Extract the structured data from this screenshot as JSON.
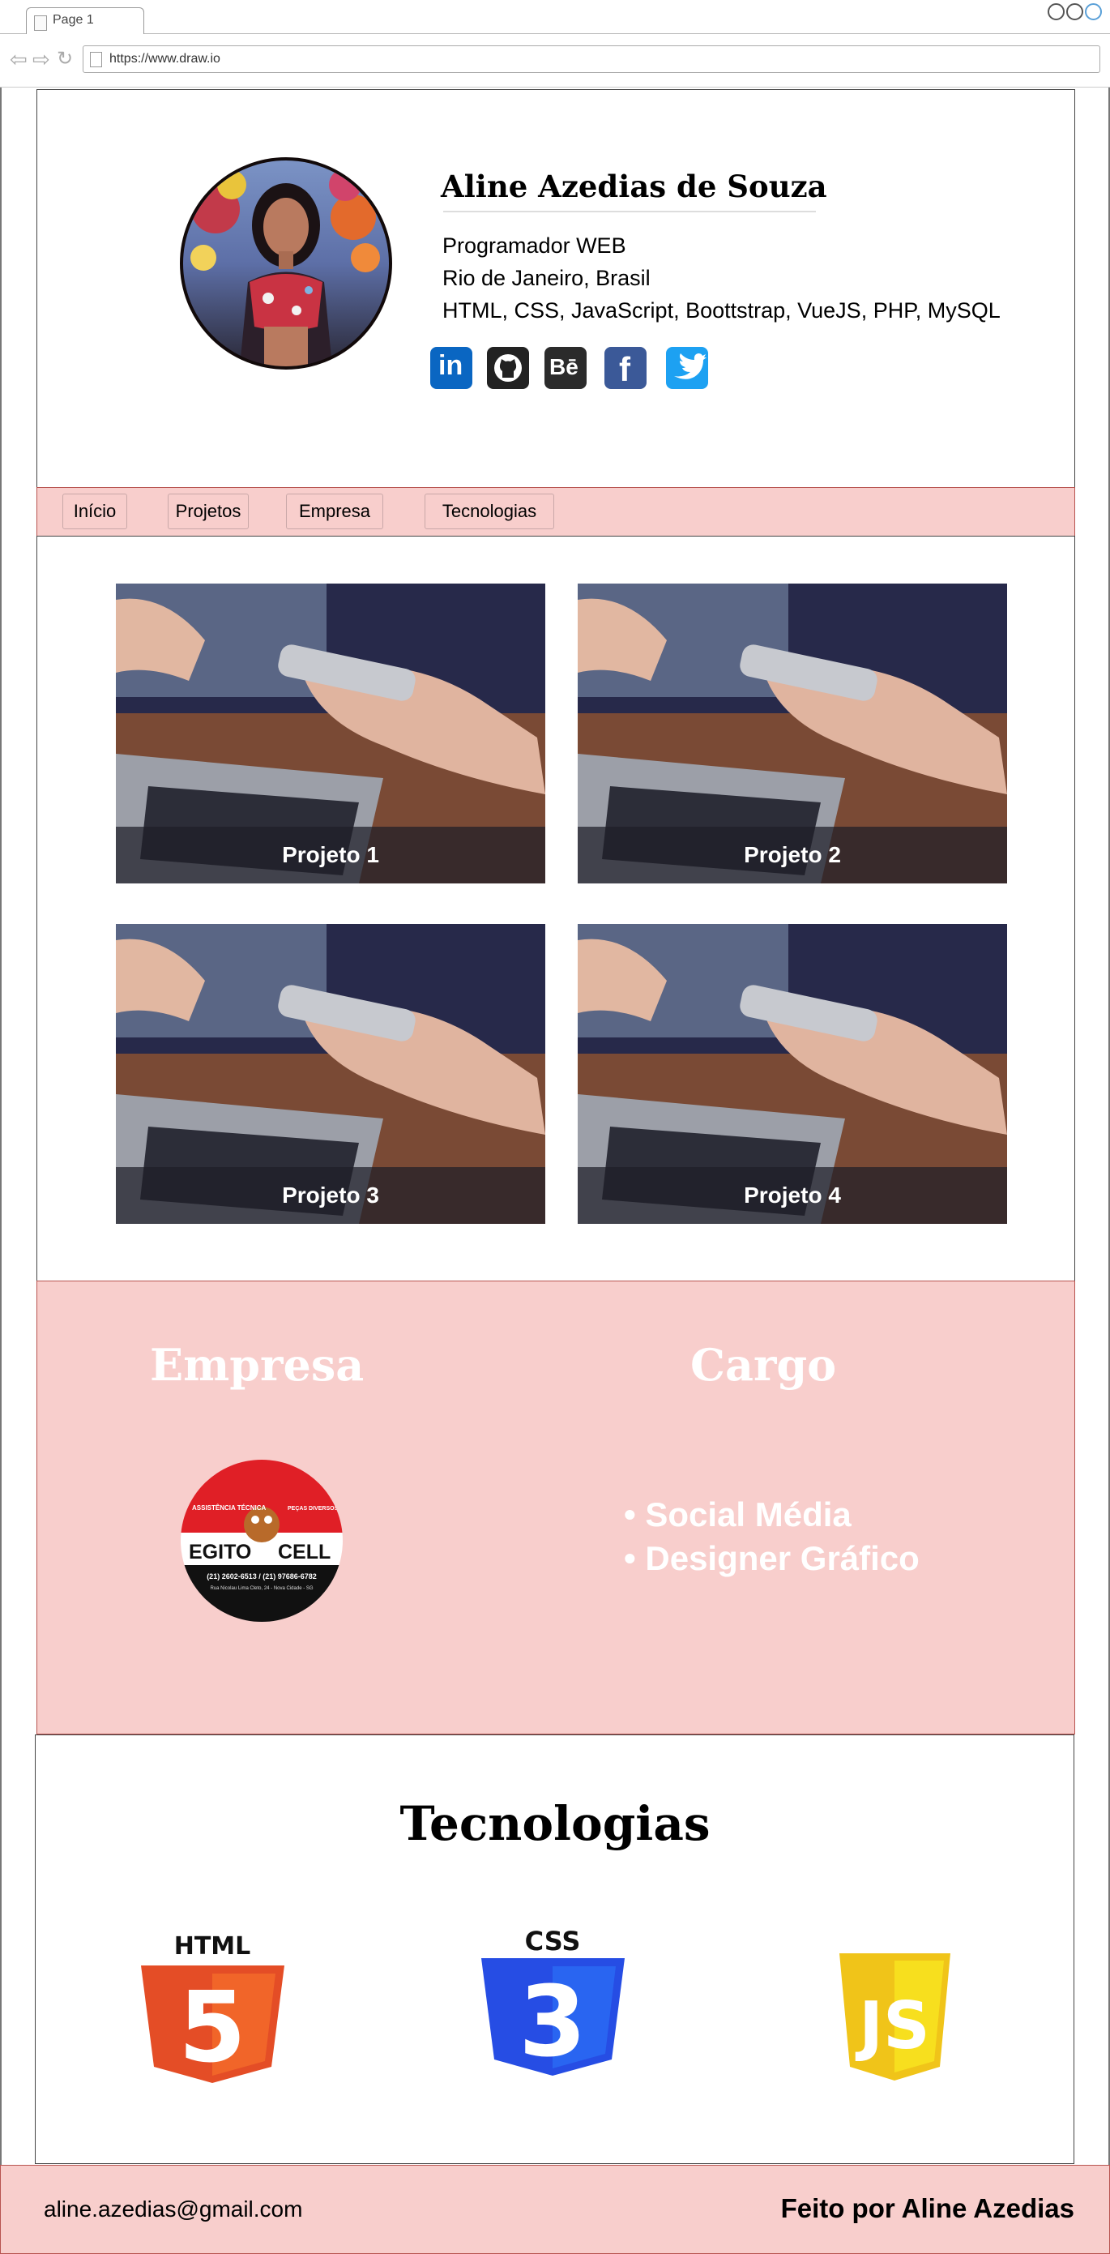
{
  "browser": {
    "tab_label": "Page 1",
    "url": "https://www.draw.io"
  },
  "profile": {
    "name": "Aline Azedias de Souza",
    "role": "Programador WEB",
    "location": "Rio de Janeiro, Brasil",
    "skills": "HTML, CSS, JavaScript, Boottstrap, VueJS, PHP, MySQL"
  },
  "social": {
    "linkedin": "in",
    "behance": "Bē",
    "facebook": "f"
  },
  "menu": {
    "items": [
      "Início",
      "Projetos",
      "Empresa",
      "Tecnologias"
    ]
  },
  "projects": [
    {
      "title": "Projeto 1"
    },
    {
      "title": "Projeto 2"
    },
    {
      "title": "Projeto 3"
    },
    {
      "title": "Projeto 4"
    }
  ],
  "company": {
    "title_company": "Empresa",
    "title_role": "Cargo",
    "roles": [
      "Social Média",
      "Designer Gráfico"
    ],
    "logo": {
      "top_left": "ASSISTÊNCIA TÉCNICA",
      "top_right": "PEÇAS DIVERSOS ACESSÓRIOS",
      "brand_left": "EGITO",
      "brand_right": "CELL",
      "phones": "(21) 2602-6513 / (21) 97686-6782",
      "address": "Rua Nicolau Lima Cleto, 24 - Nova Cidade - SG"
    }
  },
  "technologies": {
    "title": "Tecnologias",
    "html_label": "HTML",
    "css_label": "CSS",
    "html_glyph": "5",
    "css_glyph": "3",
    "js_glyph": "JS"
  },
  "footer": {
    "email": "aline.azedias@gmail.com",
    "credit": "Feito por Aline Azedias"
  },
  "colors": {
    "accent_pink": "#f8cecc",
    "html_orange": "#e44d26",
    "css_blue": "#264de4",
    "js_yellow": "#f0c419",
    "linkedin_blue": "#0a66c2",
    "twitter_blue": "#1da1f2",
    "facebook_blue": "#3b5998"
  }
}
